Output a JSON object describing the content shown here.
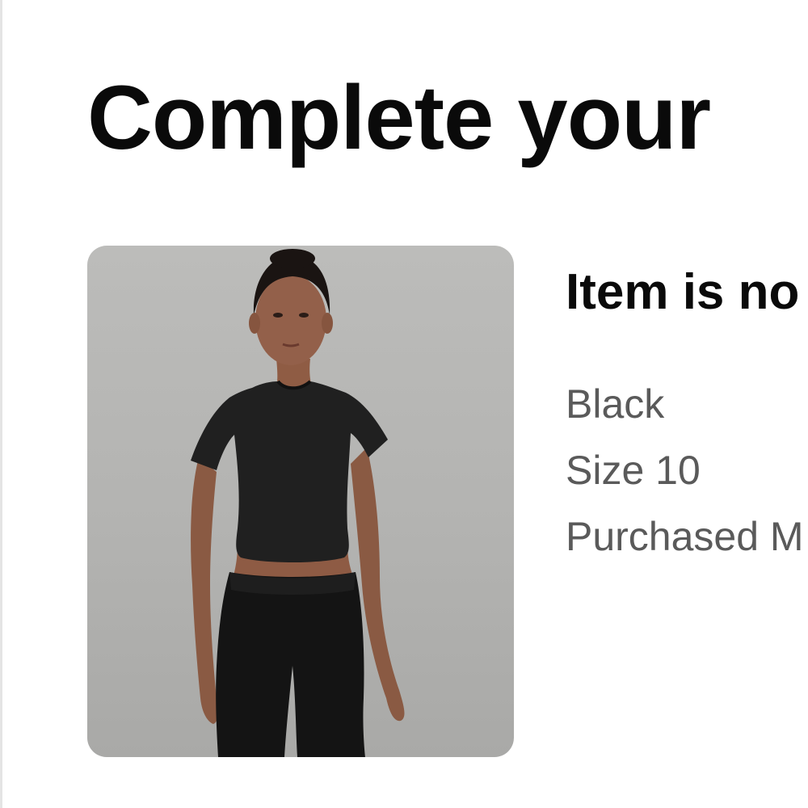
{
  "page": {
    "title": "Complete your"
  },
  "product": {
    "image_alt": "Model wearing black short-sleeve cropped top and black leggings",
    "status": "Item is no",
    "color": "Black",
    "size": "Size 10",
    "purchased": "Purchased M"
  },
  "colors": {
    "text_primary": "#0a0a0a",
    "text_secondary": "#5a5a5a",
    "card_background": "#b8b8b6"
  }
}
